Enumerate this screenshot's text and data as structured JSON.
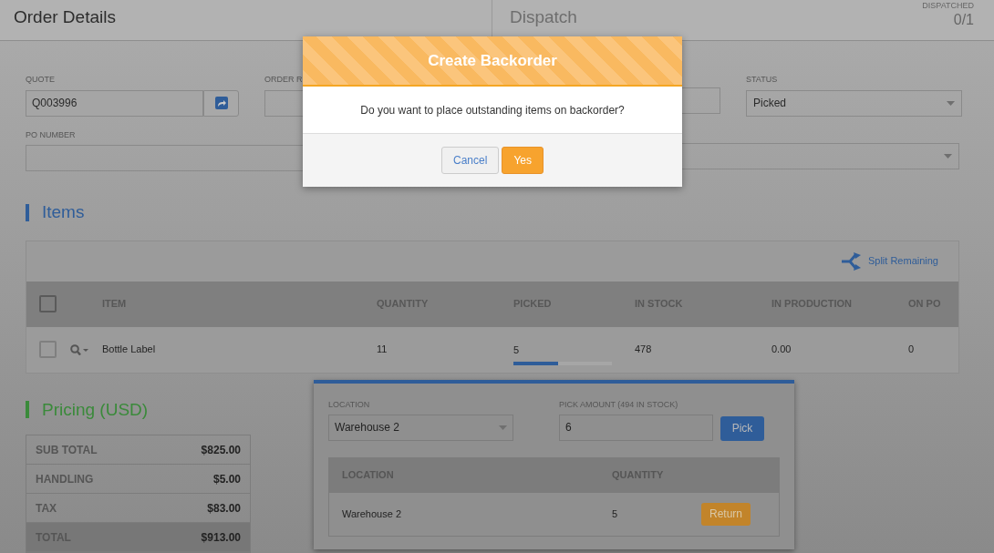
{
  "header": {
    "title": "Order Details",
    "section": "Dispatch",
    "dispatched_label": "DISPATCHED",
    "dispatched_value": "0/1"
  },
  "form": {
    "quote": {
      "label": "QUOTE",
      "value": "Q003996"
    },
    "order_ref": {
      "label": "ORDER R"
    },
    "status": {
      "label": "STATUS",
      "value": "Picked"
    },
    "po_number": {
      "label": "PO NUMBER"
    }
  },
  "items": {
    "title": "Items",
    "split_action": "Split Remaining",
    "columns": [
      "ITEM",
      "QUANTITY",
      "PICKED",
      "IN STOCK",
      "IN PRODUCTION",
      "ON PO"
    ],
    "header_checked": false,
    "rows": [
      {
        "checked": false,
        "item": "Bottle Label",
        "quantity": "11",
        "picked": "5",
        "level": 0.45,
        "in_stock": "478",
        "in_production": "0.00",
        "on_po": "0"
      }
    ]
  },
  "pick_panel": {
    "location_label": "LOCATION",
    "location_value": "Warehouse 2",
    "amount_label": "PICK AMOUNT (494 IN STOCK)",
    "amount_value": "6",
    "pick_button": "Pick",
    "columns": [
      "LOCATION",
      "QUANTITY"
    ],
    "rows": [
      {
        "location": "Warehouse 2",
        "quantity": "5",
        "action": "Return"
      }
    ]
  },
  "pricing": {
    "title": "Pricing (USD)",
    "rows": [
      {
        "label": "SUB TOTAL",
        "value": "$825.00",
        "total": false
      },
      {
        "label": "HANDLING",
        "value": "$5.00",
        "total": false
      },
      {
        "label": "TAX",
        "value": "$83.00",
        "total": false
      },
      {
        "label": "TOTAL",
        "value": "$913.00",
        "total": true
      }
    ]
  },
  "dialog": {
    "title": "Create Backorder",
    "message": "Do you want to place outstanding items on backorder?",
    "buttons": [
      {
        "label": "Cancel",
        "kind": "secondary"
      },
      {
        "label": "Yes",
        "kind": "primary"
      }
    ]
  }
}
